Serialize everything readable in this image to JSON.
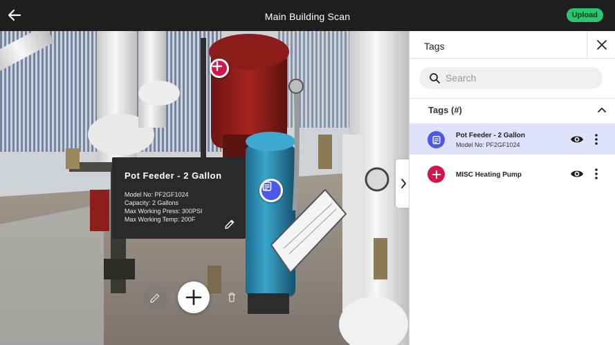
{
  "header": {
    "title": "Main Building Scan",
    "upload_label": "Upload"
  },
  "scene": {
    "info_card": {
      "title": "Pot Feeder - 2 Gallon",
      "lines": [
        "Model No: PF2GF1024",
        "Capacity: 2 Gallons",
        "Max Working Press: 300PSI",
        "Max Working Temp: 200F"
      ]
    }
  },
  "panel": {
    "title": "Tags",
    "search_placeholder": "Search",
    "section_title": "Tags (#)",
    "tags": [
      {
        "name": "Pot Feeder - 2 Gallon",
        "subtitle": "Model No: PF2GF1024",
        "icon": "note-icon",
        "color": "#4c58ea",
        "selected": true
      },
      {
        "name": "MISC Heating Pump",
        "subtitle": "",
        "icon": "plus-icon",
        "color": "#d4154a",
        "selected": false
      }
    ]
  },
  "colors": {
    "accent_blue": "#4c58ea",
    "accent_red": "#d4154a",
    "upload_green": "#27c76f",
    "selected_row": "#dfe2fb"
  }
}
